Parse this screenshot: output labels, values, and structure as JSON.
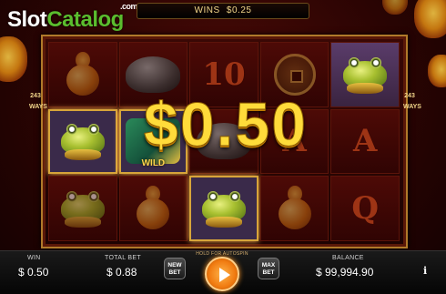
{
  "branding": {
    "logo_slot": "Slot",
    "logo_catalog": "Catalog",
    "logo_com": ".com"
  },
  "top_banner": {
    "label": "WINS",
    "value": "$0.25"
  },
  "side_text": {
    "left": "243\nWAYS",
    "right": "243\nWAYS"
  },
  "win_overlay": {
    "amount": "$0.50"
  },
  "reels": [
    {
      "row": 0,
      "symbols": [
        "gourd",
        "turtle",
        "10",
        "coin",
        "frog"
      ]
    },
    {
      "row": 1,
      "symbols": [
        "frog-win",
        "wild-dragon",
        "turtle",
        "A",
        "A"
      ]
    },
    {
      "row": 2,
      "symbols": [
        "frog",
        "gourd",
        "frog-win",
        "gourd",
        "Q"
      ]
    }
  ],
  "wild_label": "WILD",
  "card_glyphs": {
    "ten": "10",
    "ace": "A",
    "queen": "Q"
  },
  "footer": {
    "win_label": "WIN",
    "win_value": "$ 0.50",
    "total_bet_label": "TOTAL BET",
    "total_bet_value": "$ 0.88",
    "new_bet_label": "NEW\nBET",
    "spin_hint": "HOLD FOR AUTOSPIN",
    "max_bet_label": "MAX\nBET",
    "balance_label": "BALANCE",
    "balance_value": "$ 99,994.90",
    "info_label": "i"
  },
  "colors": {
    "accent_gold": "#ffdb3a",
    "spin_orange": "#f07a10",
    "logo_green": "#5bbd2e",
    "frame_gold": "#b07a2a"
  }
}
